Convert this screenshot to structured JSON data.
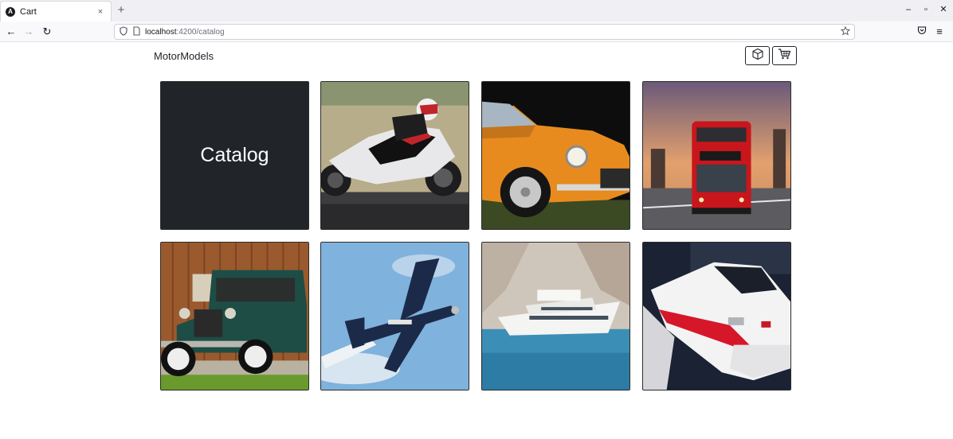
{
  "browser": {
    "tab_title": "Cart",
    "tab_favicon": "A",
    "tab_close": "×",
    "new_tab": "+",
    "window_controls": {
      "minimize": "–",
      "maximize": "▫",
      "close": "✕"
    },
    "nav": {
      "back": "←",
      "forward": "→",
      "reload": "↻"
    },
    "url_host": "localhost",
    "url_rest": ":4200/catalog",
    "menu": "≡"
  },
  "header": {
    "brand": "MotorModels",
    "buttons": [
      {
        "icon": "box-icon"
      },
      {
        "icon": "cart-icon"
      }
    ]
  },
  "catalog": {
    "title": "Catalog",
    "items": [
      {
        "icon": "motorcycle-image"
      },
      {
        "icon": "sports-car-image"
      },
      {
        "icon": "double-decker-bus-image"
      },
      {
        "icon": "vintage-car-image"
      },
      {
        "icon": "airplane-image"
      },
      {
        "icon": "yacht-image"
      },
      {
        "icon": "train-image"
      }
    ]
  }
}
